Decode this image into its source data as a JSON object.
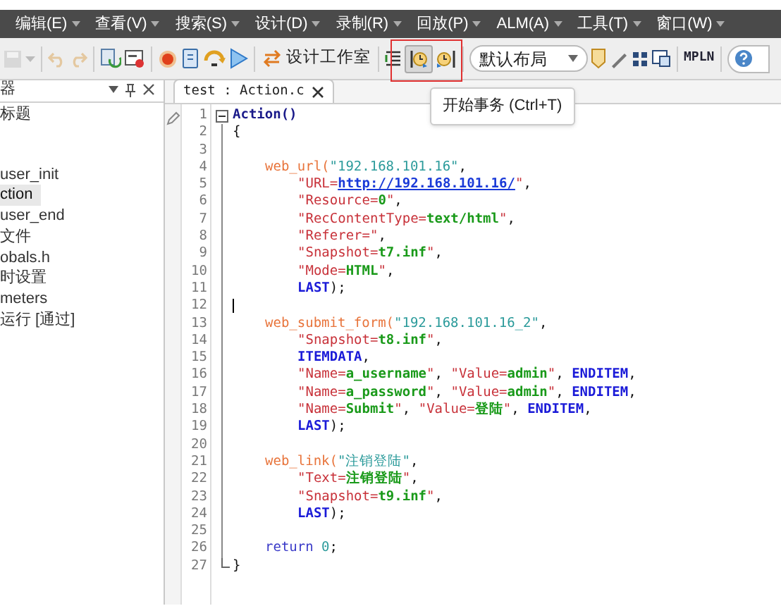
{
  "menu_bar": [
    {
      "label": "编辑(E)"
    },
    {
      "label": "查看(V)"
    },
    {
      "label": "搜索(S)"
    },
    {
      "label": "设计(D)"
    },
    {
      "label": "录制(R)"
    },
    {
      "label": "回放(P)"
    },
    {
      "label": "ALM(A)"
    },
    {
      "label": "工具(T)"
    },
    {
      "label": "窗口(W)"
    }
  ],
  "toolbar": {
    "studio_button": "设计工作室",
    "layout_dropdown": "默认布局",
    "mpln_button": "MPLN"
  },
  "tooltip": "开始事务 (Ctrl+T)",
  "explorer": {
    "title": "器",
    "items": [
      {
        "label": "标题",
        "selected": false,
        "gap_after": true
      },
      {
        "label": "user_init",
        "selected": false
      },
      {
        "label": "ction",
        "selected": true
      },
      {
        "label": "user_end",
        "selected": false
      },
      {
        "label": "文件",
        "selected": false
      },
      {
        "label": "obals.h",
        "selected": false
      },
      {
        "label": "时设置",
        "selected": false
      },
      {
        "label": "meters",
        "selected": false
      },
      {
        "label": "运行 [通过]",
        "selected": false
      }
    ]
  },
  "editor_tab": {
    "label": "test : Action.c",
    "selected": true
  },
  "code_lines": [
    {
      "number": "1",
      "kind": "signature",
      "fold_start": true,
      "tokens": [
        {
          "kind": "fn_bold",
          "text": "Action()"
        }
      ]
    },
    {
      "number": "2",
      "kind": "signature",
      "tokens": [
        {
          "kind": "plain",
          "text": "{"
        }
      ]
    },
    {
      "number": "3",
      "kind": "signature"
    },
    {
      "number": "4",
      "kind": "statement",
      "tokens": [
        {
          "kind": "fn",
          "text": "web_url("
        },
        {
          "kind": "teal",
          "text": "\"192.168.101.16\""
        },
        {
          "kind": "plain",
          "text": ","
        }
      ]
    },
    {
      "number": "5",
      "kind": "argument",
      "tokens": [
        {
          "kind": "str",
          "text": "\"URL="
        },
        {
          "kind": "link",
          "text": "http://192.168.101.16/"
        },
        {
          "kind": "str",
          "text": "\""
        },
        {
          "kind": "plain",
          "text": ","
        }
      ]
    },
    {
      "number": "6",
      "kind": "argument",
      "tokens": [
        {
          "kind": "str",
          "text": "\"Resource="
        },
        {
          "kind": "val",
          "text": "0"
        },
        {
          "kind": "str",
          "text": "\""
        },
        {
          "kind": "plain",
          "text": ","
        }
      ]
    },
    {
      "number": "7",
      "kind": "argument",
      "tokens": [
        {
          "kind": "str",
          "text": "\"RecContentType="
        },
        {
          "kind": "val",
          "text": "text/html"
        },
        {
          "kind": "str",
          "text": "\""
        },
        {
          "kind": "plain",
          "text": ","
        }
      ]
    },
    {
      "number": "8",
      "kind": "argument",
      "tokens": [
        {
          "kind": "str",
          "text": "\"Referer=\""
        },
        {
          "kind": "plain",
          "text": ","
        }
      ]
    },
    {
      "number": "9",
      "kind": "argument",
      "tokens": [
        {
          "kind": "str",
          "text": "\"Snapshot="
        },
        {
          "kind": "val",
          "text": "t7.inf"
        },
        {
          "kind": "str",
          "text": "\""
        },
        {
          "kind": "plain",
          "text": ","
        }
      ]
    },
    {
      "number": "10",
      "kind": "argument",
      "tokens": [
        {
          "kind": "str",
          "text": "\"Mode="
        },
        {
          "kind": "val",
          "text": "HTML"
        },
        {
          "kind": "str",
          "text": "\""
        },
        {
          "kind": "plain",
          "text": ","
        }
      ]
    },
    {
      "number": "11",
      "kind": "argument",
      "tokens": [
        {
          "kind": "kw",
          "text": "LAST"
        },
        {
          "kind": "plain",
          "text": ");"
        }
      ]
    },
    {
      "number": "12",
      "kind": "signature",
      "caret": true
    },
    {
      "number": "13",
      "kind": "statement",
      "tokens": [
        {
          "kind": "fn",
          "text": "web_submit_form("
        },
        {
          "kind": "teal",
          "text": "\"192.168.101.16_2\""
        },
        {
          "kind": "plain",
          "text": ","
        }
      ]
    },
    {
      "number": "14",
      "kind": "argument",
      "tokens": [
        {
          "kind": "str",
          "text": "\"Snapshot="
        },
        {
          "kind": "val",
          "text": "t8.inf"
        },
        {
          "kind": "str",
          "text": "\""
        },
        {
          "kind": "plain",
          "text": ","
        }
      ]
    },
    {
      "number": "15",
      "kind": "argument",
      "tokens": [
        {
          "kind": "kw",
          "text": "ITEMDATA"
        },
        {
          "kind": "plain",
          "text": ","
        }
      ]
    },
    {
      "number": "16",
      "kind": "argument",
      "tokens": [
        {
          "kind": "str",
          "text": "\"Name="
        },
        {
          "kind": "val",
          "text": "a_username"
        },
        {
          "kind": "str",
          "text": "\""
        },
        {
          "kind": "plain",
          "text": ", "
        },
        {
          "kind": "str",
          "text": "\"Value="
        },
        {
          "kind": "val",
          "text": "admin"
        },
        {
          "kind": "str",
          "text": "\""
        },
        {
          "kind": "plain",
          "text": ", "
        },
        {
          "kind": "kw",
          "text": "ENDITEM"
        },
        {
          "kind": "plain",
          "text": ","
        }
      ]
    },
    {
      "number": "17",
      "kind": "argument",
      "tokens": [
        {
          "kind": "str",
          "text": "\"Name="
        },
        {
          "kind": "val",
          "text": "a_password"
        },
        {
          "kind": "str",
          "text": "\""
        },
        {
          "kind": "plain",
          "text": ", "
        },
        {
          "kind": "str",
          "text": "\"Value="
        },
        {
          "kind": "val",
          "text": "admin"
        },
        {
          "kind": "str",
          "text": "\""
        },
        {
          "kind": "plain",
          "text": ", "
        },
        {
          "kind": "kw",
          "text": "ENDITEM"
        },
        {
          "kind": "plain",
          "text": ","
        }
      ]
    },
    {
      "number": "18",
      "kind": "argument",
      "tokens": [
        {
          "kind": "str",
          "text": "\"Name="
        },
        {
          "kind": "val",
          "text": "Submit"
        },
        {
          "kind": "str",
          "text": "\""
        },
        {
          "kind": "plain",
          "text": ", "
        },
        {
          "kind": "str",
          "text": "\"Value="
        },
        {
          "kind": "val",
          "text": "登陆"
        },
        {
          "kind": "str",
          "text": "\""
        },
        {
          "kind": "plain",
          "text": ", "
        },
        {
          "kind": "kw",
          "text": "ENDITEM"
        },
        {
          "kind": "plain",
          "text": ","
        }
      ]
    },
    {
      "number": "19",
      "kind": "argument",
      "tokens": [
        {
          "kind": "kw",
          "text": "LAST"
        },
        {
          "kind": "plain",
          "text": ");"
        }
      ]
    },
    {
      "number": "20",
      "kind": "signature"
    },
    {
      "number": "21",
      "kind": "statement",
      "tokens": [
        {
          "kind": "fn",
          "text": "web_link("
        },
        {
          "kind": "teal",
          "text": "\"注销登陆\""
        },
        {
          "kind": "plain",
          "text": ","
        }
      ]
    },
    {
      "number": "22",
      "kind": "argument",
      "tokens": [
        {
          "kind": "str",
          "text": "\"Text="
        },
        {
          "kind": "val",
          "text": "注销登陆"
        },
        {
          "kind": "str",
          "text": "\""
        },
        {
          "kind": "plain",
          "text": ","
        }
      ]
    },
    {
      "number": "23",
      "kind": "argument",
      "tokens": [
        {
          "kind": "str",
          "text": "\"Snapshot="
        },
        {
          "kind": "val",
          "text": "t9.inf"
        },
        {
          "kind": "str",
          "text": "\""
        },
        {
          "kind": "plain",
          "text": ","
        }
      ]
    },
    {
      "number": "24",
      "kind": "argument",
      "tokens": [
        {
          "kind": "kw",
          "text": "LAST"
        },
        {
          "kind": "plain",
          "text": ");"
        }
      ]
    },
    {
      "number": "25",
      "kind": "signature"
    },
    {
      "number": "26",
      "kind": "statement",
      "tokens": [
        {
          "kind": "kw_light",
          "text": "return "
        },
        {
          "kind": "teal",
          "text": "0"
        },
        {
          "kind": "plain",
          "text": ";"
        }
      ]
    },
    {
      "number": "27",
      "kind": "signature",
      "fold_end": true,
      "tokens": [
        {
          "kind": "plain",
          "text": "}"
        }
      ]
    }
  ]
}
